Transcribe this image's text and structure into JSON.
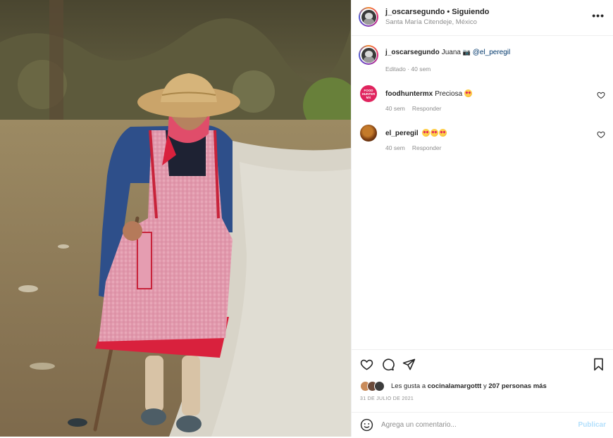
{
  "post": {
    "author": "j_oscarsegundo",
    "separator": "•",
    "follow_status": "Siguiendo",
    "location": "Santa María Citendeje, México",
    "more_label": "•••"
  },
  "caption": {
    "author": "j_oscarsegundo",
    "text": "Juana",
    "camera_glyph": "📷",
    "mention": "@el_peregil",
    "meta": "Editado · 40 sem"
  },
  "comments": [
    {
      "author": "foodhuntermx",
      "text": "Preciosa",
      "time": "40 sem",
      "reply": "Responder",
      "avatar_text": "FOOD HUNTER MX"
    },
    {
      "author": "el_peregil",
      "text": "",
      "time": "40 sem",
      "reply": "Responder"
    }
  ],
  "likes": {
    "prefix": "Les gusta a",
    "user": "cocinalamargottt",
    "middle": "y",
    "others": "207 personas más"
  },
  "date": "31 DE JULIO DE 2021",
  "add_comment": {
    "placeholder": "Agrega un comentario...",
    "publish": "Publicar"
  },
  "icons": {
    "like": "heart-icon",
    "comment": "comment-icon",
    "share": "share-icon",
    "save": "bookmark-icon",
    "emoji": "smiley-icon"
  },
  "colors": {
    "publish": "#b2dffc",
    "mention": "#00376b",
    "secondary_text": "#8e8e8e"
  }
}
